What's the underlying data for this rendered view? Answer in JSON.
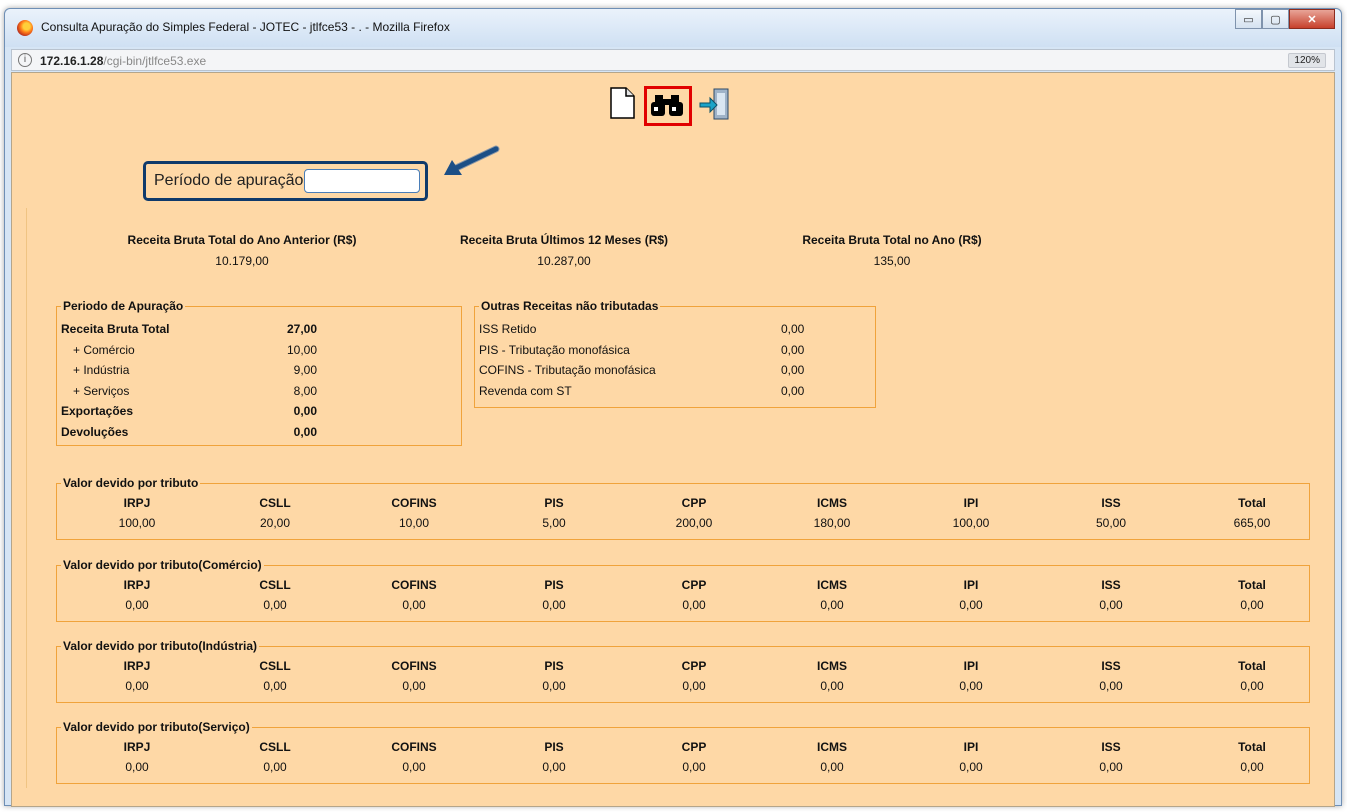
{
  "window": {
    "title": "Consulta Apuração do Simples Federal - JOTEC - jtlfce53 - . - Mozilla Firefox",
    "controls": {
      "minimize": "▭",
      "maximize": "▢",
      "close": "✕"
    }
  },
  "browser": {
    "url_host": "172.16.1.28",
    "url_path": "/cgi-bin/jtlfce53.exe",
    "zoom": "120%"
  },
  "toolbar": {
    "icons": [
      "new-document-icon",
      "binoculars-search-icon",
      "exit-door-icon"
    ],
    "highlight_color": "#e10000"
  },
  "filter": {
    "label": "Período de apuração",
    "value": "",
    "border_color": "#0f3a6b"
  },
  "receita_bruta": [
    {
      "label": "Receita Bruta Total do Ano Anterior (R$)",
      "value": "10.179,00"
    },
    {
      "label": "Receita Bruta Últimos 12 Meses (R$)",
      "value": "10.287,00"
    },
    {
      "label": "Receita Bruta Total no Ano (R$)",
      "value": "135,00"
    }
  ],
  "periodo_apuracao": {
    "title": "Periodo de Apuração",
    "rows": [
      {
        "label": "Receita Bruta Total",
        "value": "27,00",
        "bold": true
      },
      {
        "label": "+ Comércio",
        "value": "10,00",
        "bold": false
      },
      {
        "label": "+ Indústria",
        "value": "9,00",
        "bold": false
      },
      {
        "label": "+ Serviços",
        "value": "8,00",
        "bold": false
      },
      {
        "label": "Exportações",
        "value": "0,00",
        "bold": true
      },
      {
        "label": "Devoluções",
        "value": "0,00",
        "bold": true
      }
    ]
  },
  "outras_receitas": {
    "title": "Outras Receitas não tributadas",
    "rows": [
      {
        "label": "ISS Retido",
        "value": "0,00"
      },
      {
        "label": "PIS - Tributação monofásica",
        "value": "0,00"
      },
      {
        "label": "COFINS - Tributação monofásica",
        "value": "0,00"
      },
      {
        "label": "Revenda com ST",
        "value": "0,00"
      }
    ]
  },
  "tributos_headers": [
    "IRPJ",
    "CSLL",
    "COFINS",
    "PIS",
    "CPP",
    "ICMS",
    "IPI",
    "ISS",
    "Total"
  ],
  "tributos": [
    {
      "title": "Valor devido por tributo",
      "values": [
        "100,00",
        "20,00",
        "10,00",
        "5,00",
        "200,00",
        "180,00",
        "100,00",
        "50,00",
        "665,00"
      ]
    },
    {
      "title": "Valor devido por tributo(Comércio)",
      "values": [
        "0,00",
        "0,00",
        "0,00",
        "0,00",
        "0,00",
        "0,00",
        "0,00",
        "0,00",
        "0,00"
      ]
    },
    {
      "title": "Valor devido por tributo(Indústria)",
      "values": [
        "0,00",
        "0,00",
        "0,00",
        "0,00",
        "0,00",
        "0,00",
        "0,00",
        "0,00",
        "0,00"
      ]
    },
    {
      "title": "Valor devido por tributo(Serviço)",
      "values": [
        "0,00",
        "0,00",
        "0,00",
        "0,00",
        "0,00",
        "0,00",
        "0,00",
        "0,00",
        "0,00"
      ]
    }
  ]
}
